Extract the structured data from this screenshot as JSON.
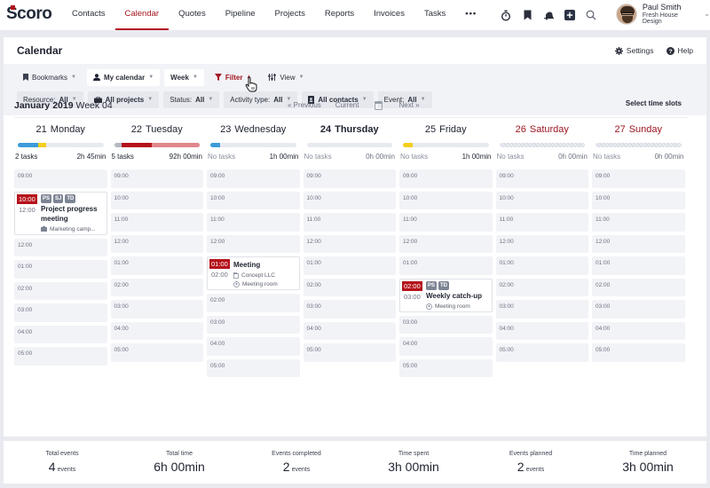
{
  "app": {
    "logo": "Scoro"
  },
  "nav": {
    "items": [
      {
        "label": "Contacts",
        "active": false
      },
      {
        "label": "Calendar",
        "active": true
      },
      {
        "label": "Quotes",
        "active": false
      },
      {
        "label": "Pipeline",
        "active": false
      },
      {
        "label": "Projects",
        "active": false
      },
      {
        "label": "Reports",
        "active": false
      },
      {
        "label": "Invoices",
        "active": false
      },
      {
        "label": "Tasks",
        "active": false
      }
    ],
    "more_label": "•••",
    "icons": [
      "stopwatch-icon",
      "bookmark-icon",
      "bell-icon",
      "add-icon",
      "search-icon"
    ]
  },
  "user": {
    "name": "Paul Smith",
    "company": "Fresh House Design"
  },
  "page": {
    "title": "Calendar",
    "settings_label": "Settings",
    "help_label": "Help"
  },
  "toolbar": {
    "bookmarks": "Bookmarks",
    "my_calendar": "My calendar",
    "week": "Week",
    "filter": "Filter",
    "view": "View",
    "filters": {
      "resource_label": "Resource:",
      "resource_value": "All",
      "projects": "All projects",
      "status_label": "Status:",
      "status_value": "All",
      "activity_label": "Activity type:",
      "activity_value": "All",
      "contacts": "All contacts",
      "event_label": "Event:",
      "event_value": "All"
    }
  },
  "week": {
    "month_year": "January 2019",
    "week_label": "Week 04",
    "previous": "« Previous",
    "current": "Current",
    "next": "Next »",
    "select_slots": "Select time slots"
  },
  "colors": {
    "accent": "#b5121b",
    "blue": "#3d9bd9",
    "yellow": "#f5cd1f",
    "red": "#b5121b",
    "light_red": "#e0878c",
    "grey": "#b4b8c2"
  },
  "days": [
    {
      "num": "21",
      "name": "Monday",
      "tasks": "2 tasks",
      "time": "2h 45min",
      "weekend": false,
      "today": false,
      "progress": [
        {
          "color": "#3d9bd9",
          "pct": 24
        },
        {
          "color": "#f5cd1f",
          "pct": 9
        }
      ],
      "slots": [
        "09:00",
        "EVENT0",
        "12:00",
        "01:00",
        "02:00",
        "03:00",
        "04:00",
        "05:00"
      ]
    },
    {
      "num": "22",
      "name": "Tuesday",
      "tasks": "5 tasks",
      "time": "92h 00min",
      "weekend": false,
      "today": false,
      "progress": [
        {
          "color": "#b4b8c2",
          "pct": 9
        },
        {
          "color": "#b5121b",
          "pct": 35
        },
        {
          "color": "#e0878c",
          "pct": 56
        }
      ],
      "slots": [
        "09:00",
        "10:00",
        "11:00",
        "12:00",
        "01:00",
        "02:00",
        "03:00",
        "04:00",
        "05:00"
      ]
    },
    {
      "num": "23",
      "name": "Wednesday",
      "tasks": "No tasks",
      "time": "1h 00min",
      "weekend": false,
      "today": false,
      "progress": [
        {
          "color": "#3d9bd9",
          "pct": 11
        }
      ],
      "slots": [
        "09:00",
        "10:00",
        "11:00",
        "12:00",
        "EVENT1",
        "02:00",
        "03:00",
        "04:00",
        "05:00"
      ]
    },
    {
      "num": "24",
      "name": "Thursday",
      "tasks": "No tasks",
      "time": "0h 00min",
      "weekend": false,
      "today": true,
      "progress": [],
      "slots": [
        "09:00",
        "10:00",
        "11:00",
        "12:00",
        "01:00",
        "02:00",
        "03:00",
        "04:00",
        "05:00"
      ]
    },
    {
      "num": "25",
      "name": "Friday",
      "tasks": "No tasks",
      "time": "1h 00min",
      "weekend": false,
      "today": false,
      "progress": [
        {
          "color": "#f5cd1f",
          "pct": 11
        }
      ],
      "slots": [
        "09:00",
        "10:00",
        "11:00",
        "12:00",
        "01:00",
        "EVENT2",
        "03:00",
        "04:00",
        "05:00"
      ]
    },
    {
      "num": "26",
      "name": "Saturday",
      "tasks": "No tasks",
      "time": "0h 00min",
      "weekend": true,
      "today": false,
      "progress": [],
      "slots": [
        "09:00",
        "10:00",
        "11:00",
        "12:00",
        "01:00",
        "02:00",
        "03:00",
        "04:00",
        "05:00"
      ]
    },
    {
      "num": "27",
      "name": "Sunday",
      "tasks": "No tasks",
      "time": "0h 00min",
      "weekend": true,
      "today": false,
      "progress": [],
      "slots": [
        "09:00",
        "10:00",
        "11:00",
        "12:00",
        "01:00",
        "02:00",
        "03:00",
        "04:00",
        "05:00"
      ]
    }
  ],
  "events": [
    {
      "start": "10:00",
      "end": "12:00",
      "tags": [
        "PS",
        "SJ",
        "TD"
      ],
      "title": "Project progress meeting",
      "meta": [
        {
          "icon": "project-icon",
          "text": "Marketing camp..."
        }
      ]
    },
    {
      "start": "01:00",
      "end": "02:00",
      "tags": [],
      "title": "Meeting",
      "meta": [
        {
          "icon": "company-icon",
          "text": "Concept LLC"
        },
        {
          "icon": "location-icon",
          "text": "Meeting room"
        }
      ]
    },
    {
      "start": "02:00",
      "end": "03:00",
      "tags": [
        "PS",
        "TD"
      ],
      "title": "Weekly catch-up",
      "meta": [
        {
          "icon": "location-icon",
          "text": "Meeting room"
        }
      ]
    }
  ],
  "summary": [
    {
      "label": "Total events",
      "value": "4",
      "unit": "events"
    },
    {
      "label": "Total time",
      "value": "6h 00min",
      "unit": ""
    },
    {
      "label": "Events completed",
      "value": "2",
      "unit": "events"
    },
    {
      "label": "Time spent",
      "value": "3h 00min",
      "unit": ""
    },
    {
      "label": "Events planned",
      "value": "2",
      "unit": "events"
    },
    {
      "label": "Time planned",
      "value": "3h 00min",
      "unit": ""
    }
  ]
}
